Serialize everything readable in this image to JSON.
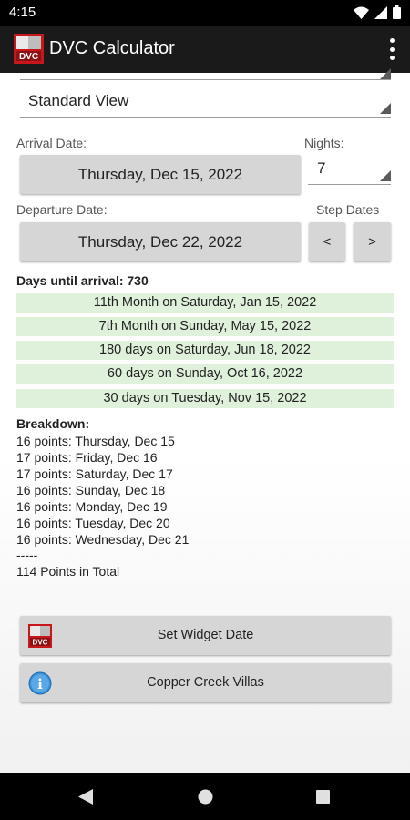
{
  "status": {
    "time": "4:15"
  },
  "app": {
    "title": "DVC Calculator",
    "logo_text": "DVC"
  },
  "view_spinner": {
    "value": "Standard View"
  },
  "arrival": {
    "label": "Arrival Date:",
    "value": "Thursday, Dec 15, 2022"
  },
  "nights": {
    "label": "Nights:",
    "value": "7"
  },
  "departure": {
    "label": "Departure Date:",
    "value": "Thursday, Dec 22, 2022"
  },
  "step": {
    "label": "Step Dates",
    "prev": "<",
    "next": ">"
  },
  "days_until": "Days until arrival: 730",
  "milestones": [
    "11th Month on Saturday, Jan 15, 2022",
    "7th Month on Sunday, May 15, 2022",
    "180 days on Saturday, Jun 18, 2022",
    "60 days on Sunday, Oct 16, 2022",
    "30 days on Tuesday, Nov 15, 2022"
  ],
  "breakdown": {
    "heading": "Breakdown:",
    "lines": [
      "16 points: Thursday, Dec 15",
      "17 points: Friday, Dec 16",
      "17 points: Saturday, Dec 17",
      "16 points: Sunday, Dec 18",
      "16 points: Monday, Dec 19",
      "16 points: Tuesday, Dec 20",
      "16 points: Wednesday, Dec 21"
    ],
    "separator": "-----",
    "total": "114 Points in Total"
  },
  "buttons": {
    "widget": "Set Widget Date",
    "resort": "Copper Creek Villas",
    "info_glyph": "i"
  },
  "colors": {
    "milestone_bg": "#dff0db",
    "button_bg": "#d6d6d6",
    "app_bar": "#1a1a1a",
    "logo_red": "#c8161d"
  }
}
